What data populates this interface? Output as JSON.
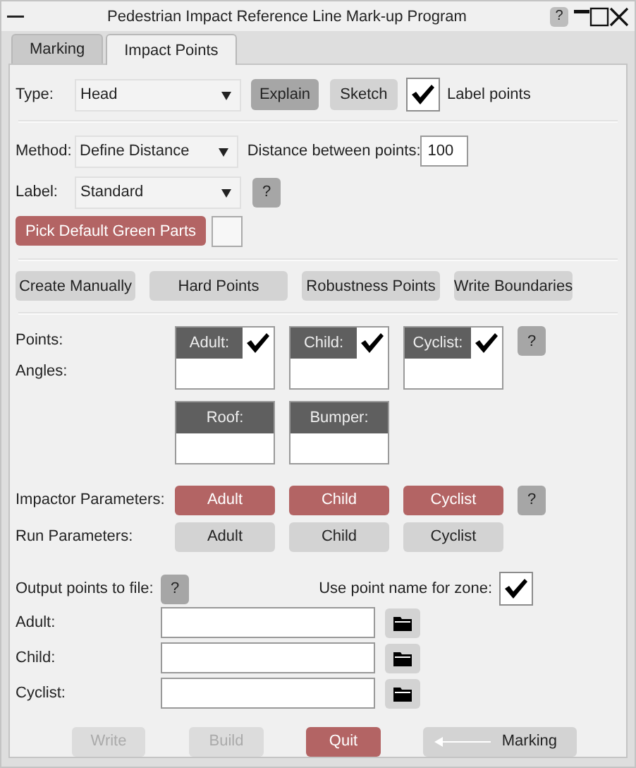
{
  "window": {
    "title": "Pedestrian Impact Reference Line Mark-up Program",
    "help": "?"
  },
  "tabs": [
    {
      "label": "Marking",
      "selected": false
    },
    {
      "label": "Impact Points",
      "selected": true
    }
  ],
  "type_row": {
    "label": "Type:",
    "value": "Head",
    "buttons": [
      {
        "label": "Explain",
        "kind": "dark"
      },
      {
        "label": "Sketch",
        "kind": "grey"
      }
    ],
    "label_points": {
      "label": "Label points",
      "checked": true
    }
  },
  "method": {
    "label": "Method:",
    "value": "Define Distance"
  },
  "distance": {
    "label": "Distance between points:",
    "value": "100"
  },
  "label_select": {
    "label": "Label:",
    "value": "Standard",
    "help": "?"
  },
  "pick": {
    "label": "Pick Default Green Parts",
    "kind": "red"
  },
  "actions": [
    {
      "label": "Create Manually",
      "kind": "grey"
    },
    {
      "label": "Hard Points",
      "kind": "grey"
    },
    {
      "label": "Robustness Points",
      "kind": "grey"
    },
    {
      "label": "Write Boundaries",
      "kind": "grey"
    }
  ],
  "points": {
    "label": "Points:",
    "angles_label": "Angles:",
    "help": "?",
    "boxes": [
      {
        "label": "Adult:",
        "kind": "check",
        "checked": true
      },
      {
        "label": "Child:",
        "kind": "check",
        "checked": true
      },
      {
        "label": "Cyclist:",
        "kind": "check",
        "checked": true
      },
      {
        "label": "Roof:",
        "kind": "plain"
      },
      {
        "label": "Bumper:",
        "kind": "plain"
      }
    ]
  },
  "impactor": {
    "label": "Impactor Parameters:",
    "help": "?",
    "buttons": [
      {
        "label": "Adult",
        "kind": "red"
      },
      {
        "label": "Child",
        "kind": "red"
      },
      {
        "label": "Cyclist",
        "kind": "red"
      }
    ]
  },
  "run": {
    "label": "Run Parameters:",
    "buttons": [
      {
        "label": "Adult",
        "kind": "grey"
      },
      {
        "label": "Child",
        "kind": "grey"
      },
      {
        "label": "Cyclist",
        "kind": "grey"
      }
    ]
  },
  "output": {
    "label": "Output points to file:",
    "help": "?",
    "zone": {
      "label": "Use point name for zone:",
      "checked": true
    },
    "files": [
      {
        "label": "Adult:"
      },
      {
        "label": "Child:"
      },
      {
        "label": "Cyclist:"
      }
    ]
  },
  "footer": [
    {
      "label": "Write",
      "kind": "disabled"
    },
    {
      "label": "Build",
      "kind": "disabled"
    },
    {
      "label": "Quit",
      "kind": "red"
    },
    {
      "label": "Marking",
      "kind": "back"
    }
  ]
}
